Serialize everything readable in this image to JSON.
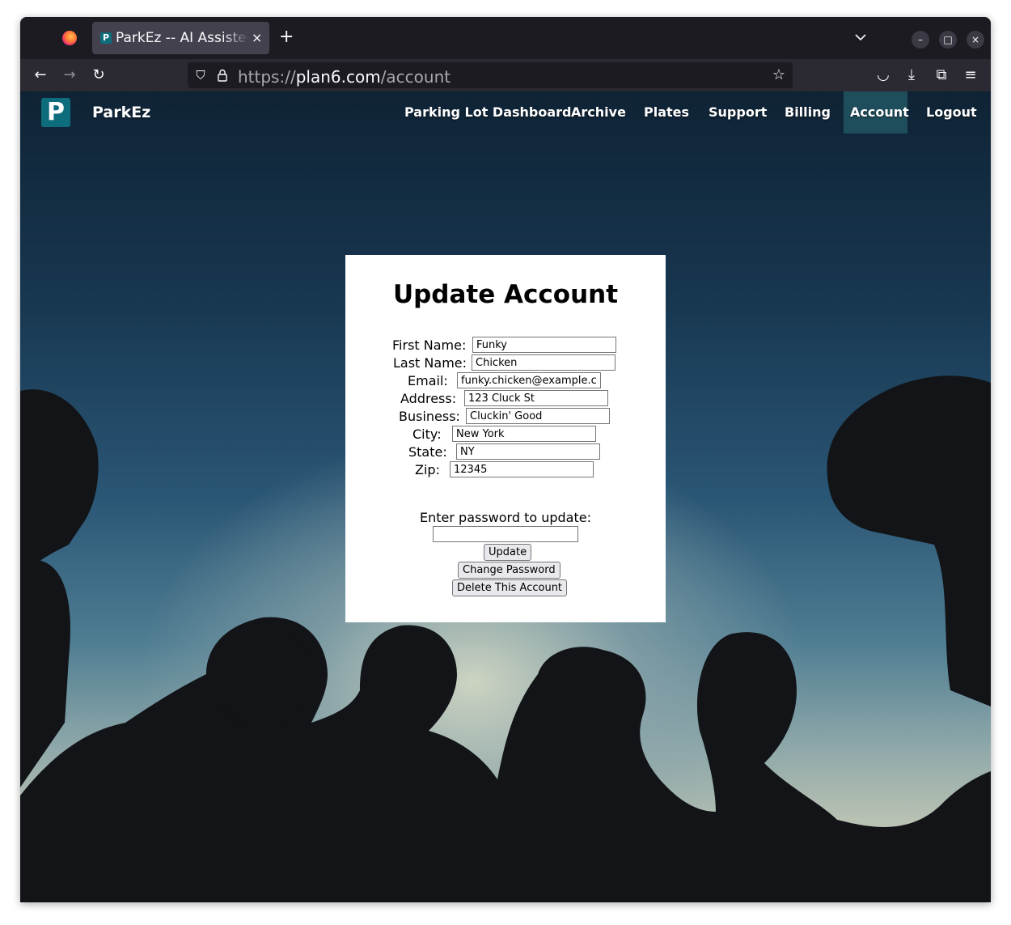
{
  "browser": {
    "tab_title": "ParkEz -- AI Assistec",
    "tab_favicon_letter": "P",
    "url_prefix": "https://",
    "url_host": "plan6.com",
    "url_path": "/account",
    "icons": {
      "back": "←",
      "forward": "→",
      "reload": "↻",
      "shield": "⛉",
      "lock": "🔒",
      "star": "☆",
      "pocket": "◡",
      "downloads": "⤓",
      "extensions": "⧉",
      "menu": "≡",
      "new_tab": "+",
      "close_tab": "×",
      "minimize": "–",
      "maximize": "□",
      "close_window": "×"
    }
  },
  "site": {
    "logo_letter": "P",
    "brand": "ParkEz",
    "nav": [
      {
        "label": "Parking Lot Dashboard"
      },
      {
        "label": "Archive"
      },
      {
        "label": "Plates"
      },
      {
        "label": "Support"
      },
      {
        "label": "Billing"
      },
      {
        "label": "Account",
        "active": true
      },
      {
        "label": "Logout"
      }
    ],
    "accent": "#0e6d7c",
    "active_nav_bg": "#1e4d5b"
  },
  "form": {
    "title": "Update Account",
    "fields": [
      {
        "label": "First Name:",
        "value": "Funky"
      },
      {
        "label": "Last Name:",
        "value": "Chicken"
      },
      {
        "label": "Email:",
        "value": "funky.chicken@example.com"
      },
      {
        "label": "Address:",
        "value": "123 Cluck St"
      },
      {
        "label": "Business:",
        "value": "Cluckin' Good"
      },
      {
        "label": "City:",
        "value": "New York"
      },
      {
        "label": "State:",
        "value": "NY"
      },
      {
        "label": "Zip:",
        "value": "12345"
      }
    ],
    "password_label": "Enter password to update:",
    "password_value": "",
    "buttons": {
      "update": "Update",
      "change_password": "Change Password",
      "delete": "Delete This Account"
    }
  }
}
